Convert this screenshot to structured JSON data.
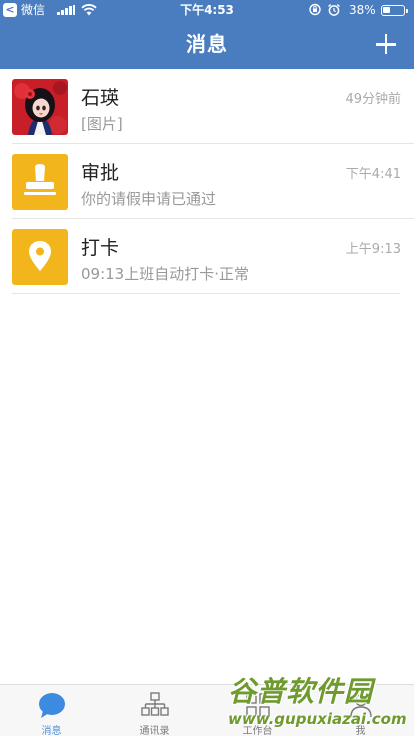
{
  "status_bar": {
    "back_glyph": "<",
    "carrier": "微信",
    "time": "下午4:53",
    "battery_text": "38%",
    "battery_level": 0.38
  },
  "nav": {
    "title": "消息"
  },
  "conversations": [
    {
      "name": "石瑛",
      "preview": "[图片]",
      "time": "49分钟前",
      "avatar": "photo"
    },
    {
      "name": "审批",
      "preview": "你的请假申请已通过",
      "time": "下午4:41",
      "avatar": "stamp-icon",
      "color": "#F2B51C"
    },
    {
      "name": "打卡",
      "preview": "09:13上班自动打卡·正常",
      "time": "上午9:13",
      "avatar": "location-pin-icon",
      "color": "#F2B51C"
    }
  ],
  "tabbar": {
    "tabs": [
      {
        "label": "消息",
        "icon": "chat-bubble-icon",
        "active": true
      },
      {
        "label": "通讯录",
        "icon": "org-chart-icon",
        "active": false
      },
      {
        "label": "工作台",
        "icon": "grid-icon",
        "active": false
      },
      {
        "label": "我",
        "icon": "person-icon",
        "active": false
      }
    ]
  },
  "watermark": {
    "title": "谷普软件园",
    "url": "www.gupuxiazai.com"
  },
  "colors": {
    "header": "#4A7CC0",
    "accent": "#4A90D9",
    "tile": "#F2B51C"
  }
}
